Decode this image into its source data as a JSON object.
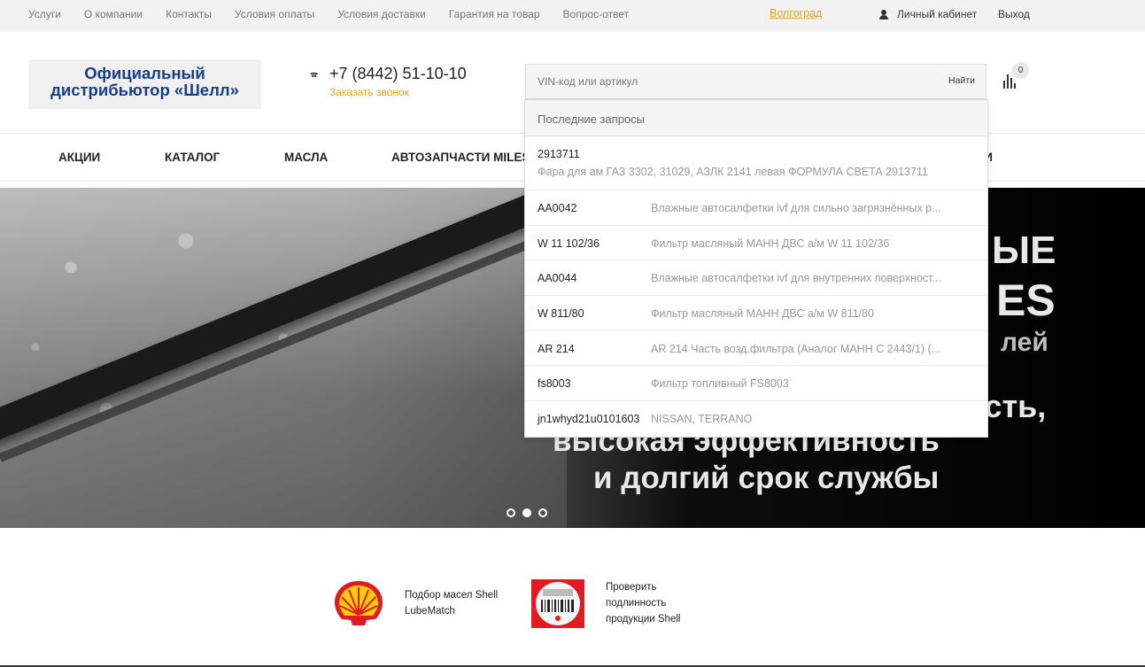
{
  "topbar": {
    "links": [
      "Услуги",
      "О компании",
      "Контакты",
      "Условия оплаты",
      "Условия доставки",
      "Гарантия на товар",
      "Вопрос-ответ"
    ],
    "city": "Волгоград",
    "cabinet": "Личный кабинет",
    "logout": "Выход"
  },
  "header": {
    "logo_line1": "Официальный",
    "logo_line2": "дистрибьютор «Шелл»",
    "phone": "+7 (8442) 51-10-10",
    "callback": "Заказать звонок",
    "compare_count": "0"
  },
  "search": {
    "placeholder": "VIN-код или артикул",
    "button": "Найти"
  },
  "nav": {
    "items": [
      "АКЦИИ",
      "КАТАЛОГ",
      "МАСЛА",
      "АВТОЗАПЧАСТИ MILES",
      "ТИ"
    ]
  },
  "banner": {
    "line1": "ЫЕ",
    "line2": "ES",
    "line3": "лей",
    "line4": "ость,",
    "line5": "высокая эффективность",
    "line6": "и долгий срок службы"
  },
  "dropdown": {
    "header": "Последние запросы",
    "first": {
      "code": "2913711",
      "desc": "Фара для ам ГАЗ 3302, 31029, АЗЛК 2141 левая ФОРМУЛА СВЕТА 2913711"
    },
    "rows": [
      {
        "code": "AA0042",
        "desc": "Влажные автосалфетки ivf для сильно загрязнённых р..."
      },
      {
        "code": "W 11 102/36",
        "desc": "Фильтр масляный МАНН ДВС а/м W 11 102/36"
      },
      {
        "code": "AA0044",
        "desc": "Влажные автосалфетки ivf для внутренних поверхност..."
      },
      {
        "code": "W 811/80",
        "desc": "Фильтр масляный МАНН ДВС а/м W 811/80"
      },
      {
        "code": "AR 214",
        "desc": "AR 214 Часть возд.фильтра (Аналог МАНН C 2443/1) (..."
      },
      {
        "code": "fs8003",
        "desc": "Фильтр топливный FS8003"
      },
      {
        "code": "jn1whyd21u0101603",
        "desc": "NISSAN, TERRANO"
      }
    ]
  },
  "promo": {
    "lubematch_line1": "Подбор масел Shell",
    "lubematch_line2": "LubeMatch",
    "verify_line1": "Проверить",
    "verify_line2": "подлинность",
    "verify_line3": "продукции Shell"
  },
  "colors": {
    "accent": "#e3a31c",
    "logo_blue": "#173f86",
    "shell_red": "#e21b23",
    "shell_yellow": "#fbce07"
  }
}
